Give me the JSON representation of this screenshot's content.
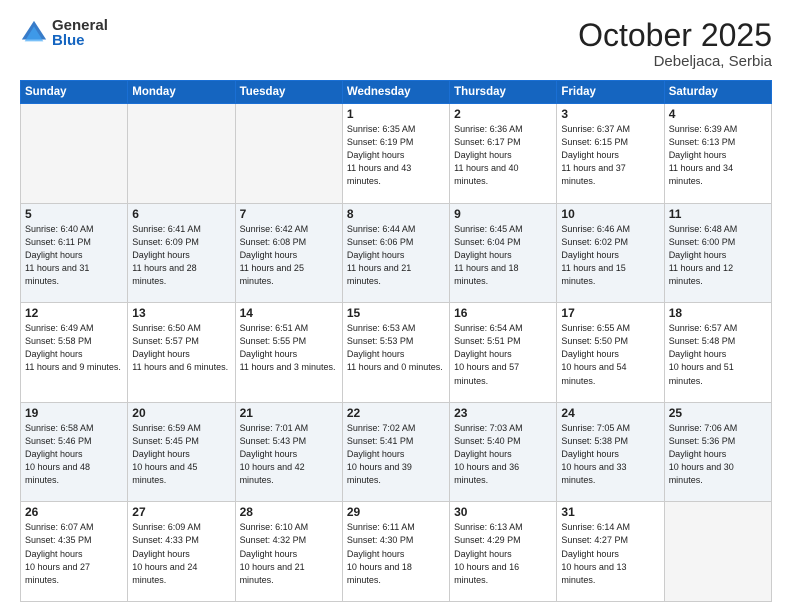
{
  "header": {
    "logo_general": "General",
    "logo_blue": "Blue",
    "month": "October 2025",
    "location": "Debeljaca, Serbia"
  },
  "days_of_week": [
    "Sunday",
    "Monday",
    "Tuesday",
    "Wednesday",
    "Thursday",
    "Friday",
    "Saturday"
  ],
  "weeks": [
    [
      {
        "day": "",
        "empty": true
      },
      {
        "day": "",
        "empty": true
      },
      {
        "day": "",
        "empty": true
      },
      {
        "day": "1",
        "sunrise": "6:35 AM",
        "sunset": "6:19 PM",
        "daylight": "11 hours and 43 minutes."
      },
      {
        "day": "2",
        "sunrise": "6:36 AM",
        "sunset": "6:17 PM",
        "daylight": "11 hours and 40 minutes."
      },
      {
        "day": "3",
        "sunrise": "6:37 AM",
        "sunset": "6:15 PM",
        "daylight": "11 hours and 37 minutes."
      },
      {
        "day": "4",
        "sunrise": "6:39 AM",
        "sunset": "6:13 PM",
        "daylight": "11 hours and 34 minutes."
      }
    ],
    [
      {
        "day": "5",
        "sunrise": "6:40 AM",
        "sunset": "6:11 PM",
        "daylight": "11 hours and 31 minutes."
      },
      {
        "day": "6",
        "sunrise": "6:41 AM",
        "sunset": "6:09 PM",
        "daylight": "11 hours and 28 minutes."
      },
      {
        "day": "7",
        "sunrise": "6:42 AM",
        "sunset": "6:08 PM",
        "daylight": "11 hours and 25 minutes."
      },
      {
        "day": "8",
        "sunrise": "6:44 AM",
        "sunset": "6:06 PM",
        "daylight": "11 hours and 21 minutes."
      },
      {
        "day": "9",
        "sunrise": "6:45 AM",
        "sunset": "6:04 PM",
        "daylight": "11 hours and 18 minutes."
      },
      {
        "day": "10",
        "sunrise": "6:46 AM",
        "sunset": "6:02 PM",
        "daylight": "11 hours and 15 minutes."
      },
      {
        "day": "11",
        "sunrise": "6:48 AM",
        "sunset": "6:00 PM",
        "daylight": "11 hours and 12 minutes."
      }
    ],
    [
      {
        "day": "12",
        "sunrise": "6:49 AM",
        "sunset": "5:58 PM",
        "daylight": "11 hours and 9 minutes."
      },
      {
        "day": "13",
        "sunrise": "6:50 AM",
        "sunset": "5:57 PM",
        "daylight": "11 hours and 6 minutes."
      },
      {
        "day": "14",
        "sunrise": "6:51 AM",
        "sunset": "5:55 PM",
        "daylight": "11 hours and 3 minutes."
      },
      {
        "day": "15",
        "sunrise": "6:53 AM",
        "sunset": "5:53 PM",
        "daylight": "11 hours and 0 minutes."
      },
      {
        "day": "16",
        "sunrise": "6:54 AM",
        "sunset": "5:51 PM",
        "daylight": "10 hours and 57 minutes."
      },
      {
        "day": "17",
        "sunrise": "6:55 AM",
        "sunset": "5:50 PM",
        "daylight": "10 hours and 54 minutes."
      },
      {
        "day": "18",
        "sunrise": "6:57 AM",
        "sunset": "5:48 PM",
        "daylight": "10 hours and 51 minutes."
      }
    ],
    [
      {
        "day": "19",
        "sunrise": "6:58 AM",
        "sunset": "5:46 PM",
        "daylight": "10 hours and 48 minutes."
      },
      {
        "day": "20",
        "sunrise": "6:59 AM",
        "sunset": "5:45 PM",
        "daylight": "10 hours and 45 minutes."
      },
      {
        "day": "21",
        "sunrise": "7:01 AM",
        "sunset": "5:43 PM",
        "daylight": "10 hours and 42 minutes."
      },
      {
        "day": "22",
        "sunrise": "7:02 AM",
        "sunset": "5:41 PM",
        "daylight": "10 hours and 39 minutes."
      },
      {
        "day": "23",
        "sunrise": "7:03 AM",
        "sunset": "5:40 PM",
        "daylight": "10 hours and 36 minutes."
      },
      {
        "day": "24",
        "sunrise": "7:05 AM",
        "sunset": "5:38 PM",
        "daylight": "10 hours and 33 minutes."
      },
      {
        "day": "25",
        "sunrise": "7:06 AM",
        "sunset": "5:36 PM",
        "daylight": "10 hours and 30 minutes."
      }
    ],
    [
      {
        "day": "26",
        "sunrise": "6:07 AM",
        "sunset": "4:35 PM",
        "daylight": "10 hours and 27 minutes."
      },
      {
        "day": "27",
        "sunrise": "6:09 AM",
        "sunset": "4:33 PM",
        "daylight": "10 hours and 24 minutes."
      },
      {
        "day": "28",
        "sunrise": "6:10 AM",
        "sunset": "4:32 PM",
        "daylight": "10 hours and 21 minutes."
      },
      {
        "day": "29",
        "sunrise": "6:11 AM",
        "sunset": "4:30 PM",
        "daylight": "10 hours and 18 minutes."
      },
      {
        "day": "30",
        "sunrise": "6:13 AM",
        "sunset": "4:29 PM",
        "daylight": "10 hours and 16 minutes."
      },
      {
        "day": "31",
        "sunrise": "6:14 AM",
        "sunset": "4:27 PM",
        "daylight": "10 hours and 13 minutes."
      },
      {
        "day": "",
        "empty": true
      }
    ]
  ]
}
